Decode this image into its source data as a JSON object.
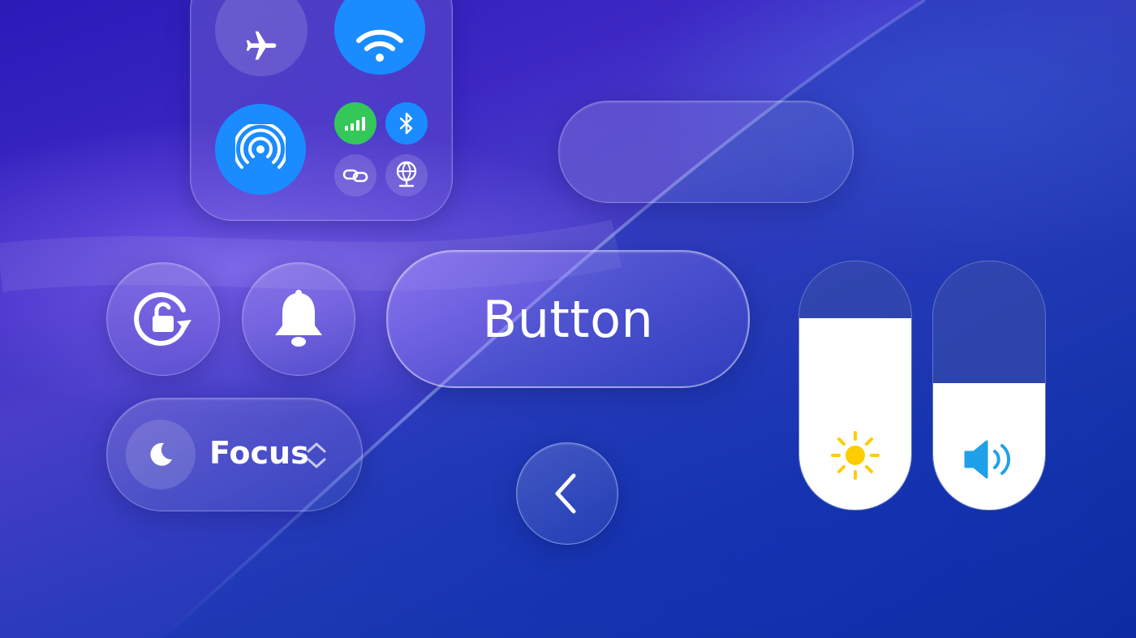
{
  "control_center": {
    "airplane": {
      "icon": "airplane-icon",
      "active": false
    },
    "wifi": {
      "icon": "wifi-icon",
      "active": true
    },
    "airdrop": {
      "icon": "airdrop-icon",
      "active": true
    },
    "cellular": {
      "icon": "cellular-icon",
      "active": true
    },
    "bluetooth": {
      "icon": "bluetooth-icon",
      "active": true
    },
    "hotspot": {
      "icon": "link-icon",
      "active": false
    },
    "vpn": {
      "icon": "globe-network-icon",
      "active": false
    }
  },
  "button": {
    "label": "Button"
  },
  "rotation_lock": {
    "icon": "rotation-lock-icon"
  },
  "bell": {
    "icon": "bell-icon"
  },
  "focus": {
    "label": "Focus",
    "icon": "moon-icon"
  },
  "back": {
    "icon": "chevron-left-icon"
  },
  "brightness": {
    "icon": "sun-icon",
    "level": 0.77
  },
  "volume": {
    "icon": "speaker-icon",
    "level": 0.51
  },
  "colors": {
    "accent_blue": "#1a8cff",
    "green": "#34c759",
    "sun": "#ffcc00",
    "speaker": "#1ea1e8"
  }
}
